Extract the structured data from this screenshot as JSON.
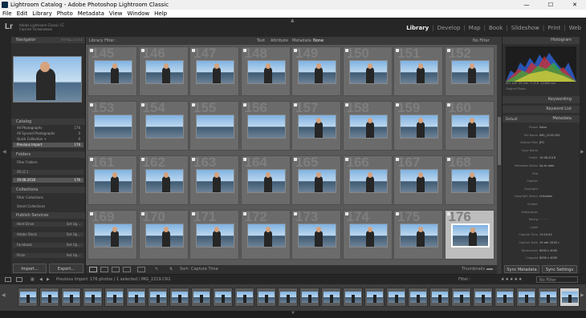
{
  "window": {
    "title": "Lightroom Catalog - Adobe Photoshop Lightroom Classic",
    "min": "—",
    "max": "☐",
    "close": "✕"
  },
  "menu": [
    "File",
    "Edit",
    "Library",
    "Photo",
    "Metadata",
    "View",
    "Window",
    "Help"
  ],
  "identity": {
    "logo": "Lr",
    "line1": "Adobe Lightroom Classic CC",
    "line2": "Сергей Телевчиков"
  },
  "modules": [
    "Library",
    "Develop",
    "Map",
    "Book",
    "Slideshow",
    "Print",
    "Web"
  ],
  "left": {
    "navigator": {
      "title": "Navigator",
      "zoom": "FIT   FILL   1:1   3:1"
    },
    "catalog": {
      "title": "Catalog",
      "items": [
        {
          "label": "All Photographs",
          "count": "176"
        },
        {
          "label": "All Synced Photographs",
          "count": "0"
        },
        {
          "label": "Quick Collection +",
          "count": "0"
        },
        {
          "label": "Previous Import",
          "count": "176"
        }
      ]
    },
    "folders": {
      "title": "Folders",
      "filter": "Filter Folders",
      "drive": "OS (C:)",
      "folder": "19.08.2018",
      "folder_count": "176"
    },
    "collections": {
      "title": "Collections",
      "filter": "Filter Collections",
      "smart": "Smart Collections"
    },
    "publish": {
      "title": "Publish Services",
      "items": [
        "Hard Drive",
        "Adobe Stock",
        "Facebook",
        "Flickr"
      ],
      "setup": "Set Up..."
    },
    "import_btn": "Import...",
    "export_btn": "Export..."
  },
  "grid": {
    "header": {
      "label": "Library Filter :",
      "text": "Text",
      "attribute": "Attribute",
      "metadata": "Metadata",
      "none": "None",
      "filters_off": "No Filter"
    },
    "numbers": [
      "145",
      "146",
      "147",
      "148",
      "149",
      "150",
      "151",
      "152",
      "153",
      "154",
      "155",
      "156",
      "157",
      "158",
      "159",
      "160",
      "161",
      "162",
      "163",
      "164",
      "165",
      "166",
      "167",
      "168",
      "169",
      "170",
      "171",
      "172",
      "173",
      "174",
      "175",
      "176"
    ]
  },
  "gridtoolbar": {
    "sort_label": "Sort:",
    "sort_value": "Capture Time",
    "thumbnails_label": "Thumbnails"
  },
  "right": {
    "histogram": "Histogram",
    "histo_info": [
      "ISO 100",
      "35 mm",
      "f / 5.6",
      "1/1600 sec"
    ],
    "original": "Original Photo",
    "keywording": "Keywording",
    "keywordlist": "Keyword List",
    "metadata": "Metadata",
    "preset_label": "Default",
    "rows": [
      {
        "k": "Preset",
        "v": "None"
      },
      {
        "k": "File Name",
        "v": "IMG_2219.CR2"
      },
      {
        "k": "Sidecar Files",
        "v": "JPG"
      },
      {
        "k": "Copy Name",
        "v": ""
      },
      {
        "k": "Folder",
        "v": "19.08.2018"
      },
      {
        "k": "Metadata Status",
        "v": "Up to date"
      },
      {
        "k": "Title",
        "v": ""
      },
      {
        "k": "Caption",
        "v": ""
      },
      {
        "k": "Copyright",
        "v": ""
      },
      {
        "k": "Copyright Status",
        "v": "Unknown"
      },
      {
        "k": "Creator",
        "v": ""
      },
      {
        "k": "Sublocation",
        "v": ""
      },
      {
        "k": "Rating",
        "v": "· · · · ·"
      },
      {
        "k": "Label",
        "v": ""
      },
      {
        "k": "Capture Time",
        "v": "13:24:45"
      },
      {
        "k": "Capture Date",
        "v": "19 авг 2018 г."
      },
      {
        "k": "Dimensions",
        "v": "6000 x 4000"
      },
      {
        "k": "Cropped",
        "v": "6000 x 4000"
      }
    ],
    "sync_btn": "Sync Metadata",
    "settings_btn": "Sync Settings"
  },
  "strip": {
    "source": "Previous Import",
    "info": "176 photos / 1 selected / IMG_2219.CR2",
    "filter_label": "Filter :",
    "filter_value": "No Filter"
  }
}
